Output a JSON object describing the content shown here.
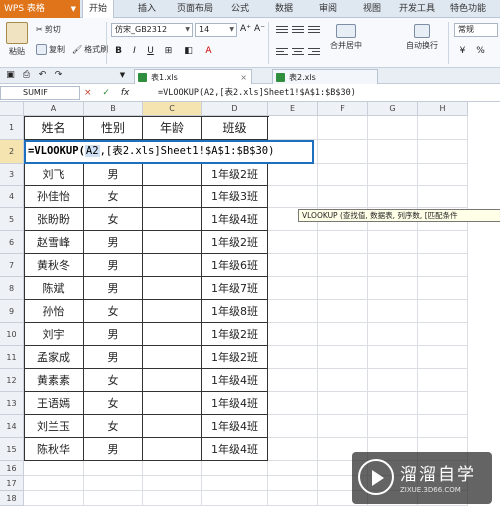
{
  "app": {
    "name": "WPS 表格"
  },
  "menu_tabs": [
    "开始",
    "插入",
    "页面布局",
    "公式",
    "数据",
    "审阅",
    "视图",
    "开发工具",
    "特色功能"
  ],
  "ribbon": {
    "paste": "粘贴",
    "cut": "剪切",
    "copy": "复制",
    "format_painter": "格式刷",
    "font_name": "仿宋_GB2312",
    "font_size": "14",
    "bold": "B",
    "italic": "I",
    "underline": "U",
    "grow_font": "A⁺",
    "shrink_font": "A⁻",
    "merge_center": "合并居中",
    "wrap_text": "自动换行",
    "number_format": "常规"
  },
  "doc_tabs": [
    {
      "label": "表1.xls",
      "active": true
    },
    {
      "label": "表2.xls",
      "active": false
    }
  ],
  "formula_bar": {
    "name_box": "SUMIF",
    "fx": "fx",
    "cancel": "×",
    "confirm": "✓",
    "formula": "=VLOOKUP(A2,[表2.xls]Sheet1!$A$1:$B$30)"
  },
  "columns": [
    "A",
    "B",
    "C",
    "D",
    "E",
    "F",
    "G",
    "H"
  ],
  "rows": [
    "1",
    "2",
    "3",
    "4",
    "5",
    "6",
    "7",
    "8",
    "9",
    "10",
    "11",
    "12",
    "13",
    "14",
    "15",
    "16",
    "17",
    "18"
  ],
  "table": {
    "headers": [
      "姓名",
      "性别",
      "年龄",
      "班级"
    ],
    "rows": [
      [
        "刘飞",
        "男",
        "",
        "1年级2班"
      ],
      [
        "孙佳怡",
        "女",
        "",
        "1年级3班"
      ],
      [
        "张盼盼",
        "女",
        "",
        "1年级4班"
      ],
      [
        "赵雪峰",
        "男",
        "",
        "1年级2班"
      ],
      [
        "黄秋冬",
        "男",
        "",
        "1年级6班"
      ],
      [
        "陈斌",
        "男",
        "",
        "1年级7班"
      ],
      [
        "孙怡",
        "女",
        "",
        "1年级8班"
      ],
      [
        "刘宇",
        "男",
        "",
        "1年级2班"
      ],
      [
        "孟家成",
        "男",
        "",
        "1年级2班"
      ],
      [
        "黄素素",
        "女",
        "",
        "1年级4班"
      ],
      [
        "王语嫣",
        "女",
        "",
        "1年级4班"
      ],
      [
        "刘兰玉",
        "女",
        "",
        "1年级4班"
      ],
      [
        "陈秋华",
        "男",
        "",
        "1年级4班"
      ]
    ]
  },
  "edit_cell": {
    "prefix": "=VLOOKUP(",
    "ref": "A2",
    "rest": ",[表2.xls]Sheet1!$A$1:$B$30)"
  },
  "tooltip": "VLOOKUP (查找值, 数据表, 列序数, [匹配条件",
  "watermark": {
    "title": "溜溜自学",
    "url": "ZIXUE.3D66.COM"
  }
}
